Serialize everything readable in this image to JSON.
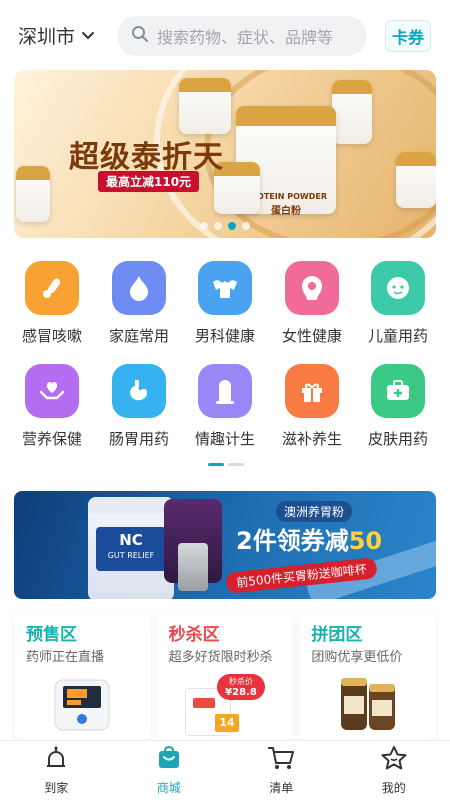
{
  "header": {
    "city": "深圳市",
    "search_placeholder": "搜索药物、症状、品牌等",
    "coupon_button": "卡券"
  },
  "banner": {
    "title": "超级泰折天",
    "badge": "最高立减110元",
    "product_label": "蛋白粉",
    "product_brand": "PROTEIN POWDER",
    "active_dot": 3,
    "dot_count": 4
  },
  "categories": [
    {
      "label": "感冒咳嗽",
      "icon": "thermometer-icon",
      "color": "#f7a233"
    },
    {
      "label": "家庭常用",
      "icon": "flame-icon",
      "color": "#6f8cf5"
    },
    {
      "label": "男科健康",
      "icon": "muscle-icon",
      "color": "#4aa3f0"
    },
    {
      "label": "女性健康",
      "icon": "woman-icon",
      "color": "#f06b9a"
    },
    {
      "label": "儿童用药",
      "icon": "baby-face-icon",
      "color": "#3ccaa8"
    },
    {
      "label": "营养保健",
      "icon": "hand-heart-icon",
      "color": "#b46df0"
    },
    {
      "label": "肠胃用药",
      "icon": "stomach-icon",
      "color": "#37b2f0"
    },
    {
      "label": "情趣计生",
      "icon": "condom-icon",
      "color": "#9b86f5"
    },
    {
      "label": "滋补养生",
      "icon": "gift-icon",
      "color": "#f77b43"
    },
    {
      "label": "皮肤用药",
      "icon": "medical-kit-icon",
      "color": "#3cc985"
    }
  ],
  "promo": {
    "tag": "澳洲养胃粉",
    "headline_prefix": "2件领券减",
    "headline_number": "50",
    "sub": "前500件买胃粉送咖啡杯",
    "jar_brand": "NC",
    "jar_name": "GUT RELIEF"
  },
  "zones": [
    {
      "title": "预售区",
      "desc": "药师正在直播",
      "color": "#17b3b0"
    },
    {
      "title": "秒杀区",
      "desc": "超多好货限时秒杀",
      "color": "#e8494e",
      "price_tag": "秒杀价",
      "price": "¥28.8"
    },
    {
      "title": "拼团区",
      "desc": "团购优享更低价",
      "color": "#17b3b0"
    }
  ],
  "tabbar": [
    {
      "label": "到家",
      "icon": "home-bell-icon",
      "active": false
    },
    {
      "label": "商城",
      "icon": "shopping-bag-icon",
      "active": true
    },
    {
      "label": "清单",
      "icon": "cart-icon",
      "active": false
    },
    {
      "label": "我的",
      "icon": "star-face-icon",
      "active": false
    }
  ],
  "colors": {
    "accent": "#1aa6b7",
    "search_bg": "#f1f2f4"
  }
}
